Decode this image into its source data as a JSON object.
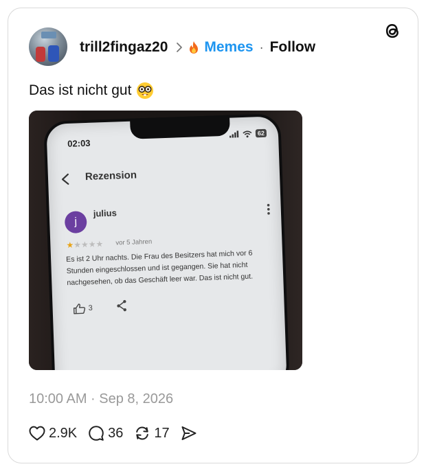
{
  "post": {
    "username": "trill2fingaz20",
    "community": "Memes",
    "follow_label": "Follow",
    "separator": "·",
    "caption": "Das ist nicht gut",
    "caption_emoji": "nerd-face",
    "timestamp": "10:00 AM · Sep 8, 2026",
    "stats": {
      "likes": "2.9K",
      "comments": "36",
      "reposts": "17"
    }
  },
  "photo": {
    "phone_time": "02:03",
    "battery": "62",
    "screen_title": "Rezension",
    "reviewer_initial": "j",
    "reviewer_name": "julius",
    "rating_stars": 1,
    "rating_max": 5,
    "review_age": "vor 5 Jahren",
    "review_text": "Es ist 2 Uhr nachts. Die Frau des Besitzers hat mich vor 6 Stunden eingeschlossen und ist gegangen. Sie hat nicht nachgesehen, ob das Geschäft leer war. Das ist nicht gut.",
    "helpful_count": "3"
  },
  "colors": {
    "community": "#1e95f0",
    "muted": "#999999",
    "avatar_j": "#6b3fa0",
    "star": "#e8a317"
  },
  "icons": [
    "threads-logo-icon",
    "chevron-right-icon",
    "fire-icon",
    "heart-icon",
    "comment-icon",
    "repost-icon",
    "share-icon"
  ]
}
